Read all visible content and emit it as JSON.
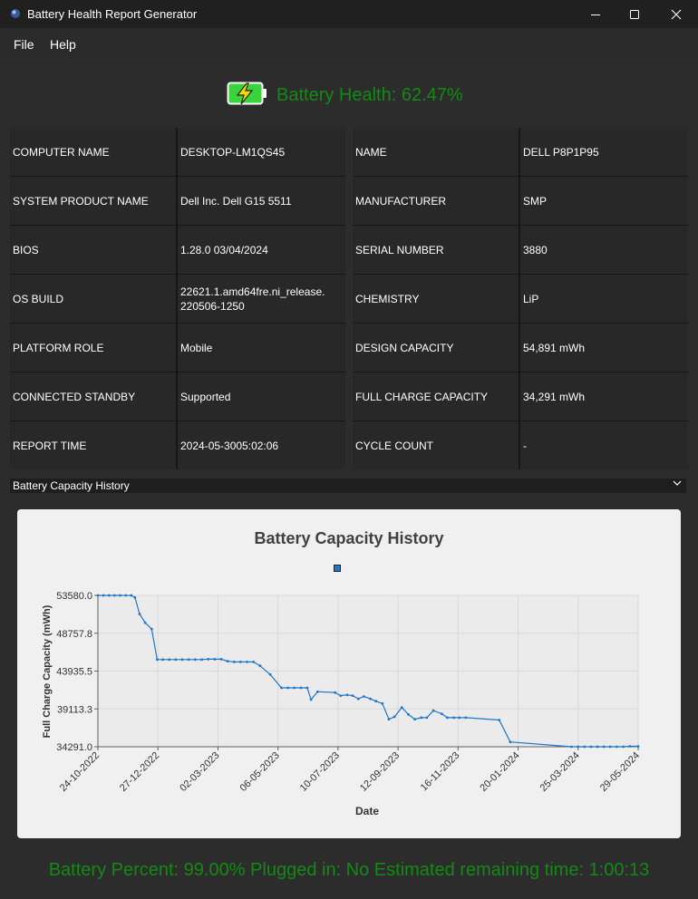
{
  "window": {
    "title": "Battery Health Report Generator",
    "controls": {
      "minimize": "—",
      "maximize": "☐",
      "close": "✕"
    }
  },
  "menu": {
    "file": "File",
    "help": "Help"
  },
  "health": {
    "text": "Battery Health: 62.47%",
    "icon": "battery-charging-icon",
    "color": "#138a13"
  },
  "system_info": [
    {
      "key": "COMPUTER NAME",
      "value": "DESKTOP-LM1QS45"
    },
    {
      "key": "SYSTEM PRODUCT NAME",
      "value": "Dell Inc. Dell G15 5511"
    },
    {
      "key": "BIOS",
      "value": "1.28.0 03/04/2024"
    },
    {
      "key": "OS BUILD",
      "value": "22621.1.amd64fre.ni_release.\n220506-1250"
    },
    {
      "key": "PLATFORM ROLE",
      "value": "Mobile"
    },
    {
      "key": "CONNECTED STANDBY",
      "value": "Supported"
    },
    {
      "key": "REPORT TIME",
      "value": "2024-05-3005:02:06"
    }
  ],
  "battery_info": [
    {
      "key": "NAME",
      "value": "DELL P8P1P95"
    },
    {
      "key": "MANUFACTURER",
      "value": "SMP"
    },
    {
      "key": "SERIAL NUMBER",
      "value": "3880"
    },
    {
      "key": "CHEMISTRY",
      "value": "LiP"
    },
    {
      "key": "DESIGN CAPACITY",
      "value": "54,891 mWh"
    },
    {
      "key": "FULL CHARGE CAPACITY",
      "value": "34,291 mWh"
    },
    {
      "key": "CYCLE COUNT",
      "value": "-"
    }
  ],
  "dropdown": {
    "selected": "Battery Capacity History"
  },
  "chart_data": {
    "type": "line",
    "title": "Battery Capacity History",
    "xlabel": "Date",
    "ylabel": "Full Charge Capacity (mWh)",
    "yticks": [
      "34291.0",
      "39113.3",
      "43935.5",
      "48757.8",
      "53580.0"
    ],
    "ylim": [
      34291.0,
      53580.0
    ],
    "xticks": [
      "24-10-2022",
      "27-12-2022",
      "02-03-2023",
      "06-05-2023",
      "10-07-2023",
      "12-09-2023",
      "16-11-2023",
      "20-01-2024",
      "25-03-2024",
      "29-05-2024"
    ],
    "xlim": [
      "2022-10-24",
      "2024-05-29"
    ],
    "grid": true,
    "legend_position": "top-center",
    "line_color": "#1f77c8",
    "points": [
      {
        "x": "2022-10-24",
        "y": 53580
      },
      {
        "x": "2022-10-30",
        "y": 53580
      },
      {
        "x": "2022-11-05",
        "y": 53580
      },
      {
        "x": "2022-11-11",
        "y": 53580
      },
      {
        "x": "2022-11-17",
        "y": 53580
      },
      {
        "x": "2022-11-23",
        "y": 53580
      },
      {
        "x": "2022-11-29",
        "y": 53580
      },
      {
        "x": "2022-12-03",
        "y": 53300
      },
      {
        "x": "2022-12-08",
        "y": 51200
      },
      {
        "x": "2022-12-14",
        "y": 50100
      },
      {
        "x": "2022-12-21",
        "y": 49300
      },
      {
        "x": "2022-12-27",
        "y": 45400
      },
      {
        "x": "2023-01-02",
        "y": 45400
      },
      {
        "x": "2023-01-09",
        "y": 45400
      },
      {
        "x": "2023-01-16",
        "y": 45400
      },
      {
        "x": "2023-01-23",
        "y": 45400
      },
      {
        "x": "2023-01-30",
        "y": 45400
      },
      {
        "x": "2023-02-06",
        "y": 45400
      },
      {
        "x": "2023-02-13",
        "y": 45400
      },
      {
        "x": "2023-02-20",
        "y": 45450
      },
      {
        "x": "2023-02-27",
        "y": 45450
      },
      {
        "x": "2023-03-06",
        "y": 45450
      },
      {
        "x": "2023-03-13",
        "y": 45200
      },
      {
        "x": "2023-03-20",
        "y": 45100
      },
      {
        "x": "2023-03-27",
        "y": 45100
      },
      {
        "x": "2023-04-03",
        "y": 45100
      },
      {
        "x": "2023-04-10",
        "y": 45100
      },
      {
        "x": "2023-04-17",
        "y": 44600
      },
      {
        "x": "2023-04-28",
        "y": 43500
      },
      {
        "x": "2023-05-10",
        "y": 41800
      },
      {
        "x": "2023-05-17",
        "y": 41800
      },
      {
        "x": "2023-05-24",
        "y": 41800
      },
      {
        "x": "2023-05-31",
        "y": 41800
      },
      {
        "x": "2023-06-07",
        "y": 41800
      },
      {
        "x": "2023-06-11",
        "y": 40300
      },
      {
        "x": "2023-06-18",
        "y": 41300
      },
      {
        "x": "2023-07-07",
        "y": 41200
      },
      {
        "x": "2023-07-13",
        "y": 40800
      },
      {
        "x": "2023-07-20",
        "y": 40900
      },
      {
        "x": "2023-07-26",
        "y": 40800
      },
      {
        "x": "2023-08-01",
        "y": 40400
      },
      {
        "x": "2023-08-07",
        "y": 40700
      },
      {
        "x": "2023-08-14",
        "y": 40400
      },
      {
        "x": "2023-08-20",
        "y": 40100
      },
      {
        "x": "2023-08-27",
        "y": 39800
      },
      {
        "x": "2023-09-03",
        "y": 37800
      },
      {
        "x": "2023-09-09",
        "y": 38100
      },
      {
        "x": "2023-09-17",
        "y": 39300
      },
      {
        "x": "2023-09-24",
        "y": 38400
      },
      {
        "x": "2023-10-01",
        "y": 37800
      },
      {
        "x": "2023-10-08",
        "y": 38000
      },
      {
        "x": "2023-10-14",
        "y": 38000
      },
      {
        "x": "2023-10-21",
        "y": 38900
      },
      {
        "x": "2023-10-30",
        "y": 38500
      },
      {
        "x": "2023-11-05",
        "y": 38000
      },
      {
        "x": "2023-11-12",
        "y": 38000
      },
      {
        "x": "2023-11-18",
        "y": 38000
      },
      {
        "x": "2023-11-25",
        "y": 38000
      },
      {
        "x": "2023-12-31",
        "y": 37700
      },
      {
        "x": "2024-01-12",
        "y": 34900
      },
      {
        "x": "2024-03-18",
        "y": 34291
      },
      {
        "x": "2024-03-25",
        "y": 34291
      },
      {
        "x": "2024-04-01",
        "y": 34291
      },
      {
        "x": "2024-04-08",
        "y": 34291
      },
      {
        "x": "2024-04-15",
        "y": 34291
      },
      {
        "x": "2024-04-22",
        "y": 34291
      },
      {
        "x": "2024-04-29",
        "y": 34291
      },
      {
        "x": "2024-05-06",
        "y": 34291
      },
      {
        "x": "2024-05-13",
        "y": 34291
      },
      {
        "x": "2024-05-20",
        "y": 34350
      },
      {
        "x": "2024-05-29",
        "y": 34350
      }
    ]
  },
  "status": {
    "text": "Battery Percent: 99.00% Plugged in: No Estimated remaining time: 1:00:13"
  }
}
